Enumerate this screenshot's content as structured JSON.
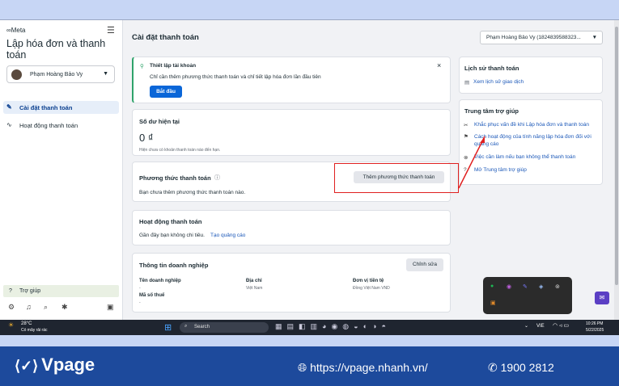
{
  "sidebar": {
    "brand": "∞Meta",
    "title": "Lập hóa đơn và thanh toán",
    "account_name": "Phạm Hoàng Bảo Vy",
    "nav": [
      {
        "label": "Cài đặt thanh toán"
      },
      {
        "label": "Hoạt động thanh toán"
      }
    ],
    "help_label": "Trợ giúp"
  },
  "header": {
    "title": "Cài đặt thanh toán",
    "account_selector": "Phạm Hoàng Bảo Vy (1824839588323..."
  },
  "setup": {
    "title": "Thiết lập tài khoản",
    "desc": "Chỉ cần thêm phương thức thanh toán và chỉ tiết lập hóa đơn lần đầu tiên",
    "button": "Bắt đầu",
    "close": "×"
  },
  "balance": {
    "title": "Số dư hiện tại",
    "value": "0 ₫",
    "note": "Hiện chưa có khoản thanh toán nào đến hạn."
  },
  "payment_method": {
    "title": "Phương thức thanh toán",
    "desc": "Bạn chưa thêm phương thức thanh toán nào.",
    "button": "Thêm phương thức thanh toán"
  },
  "activity": {
    "title": "Hoạt động thanh toán",
    "desc": "Gần đây bạn không chi tiêu.",
    "link": "Tạo quảng cáo"
  },
  "business": {
    "title": "Thông tin doanh nghiệp",
    "edit": "Chỉnh sửa",
    "fields": [
      {
        "label": "Tên doanh nghiệp",
        "value": "-"
      },
      {
        "label": "Địa chỉ",
        "value": "Việt Nam"
      },
      {
        "label": "Đơn vị tiền tệ",
        "value": "Đồng Việt Nam VND"
      },
      {
        "label": "Mã số thuế",
        "value": "-"
      }
    ]
  },
  "history": {
    "title": "Lịch sử thanh toán",
    "link": "Xem lịch sử giao dịch"
  },
  "help_center": {
    "title": "Trung tâm trợ giúp",
    "links": [
      "Khắc phục vấn đề khi Lập hóa đơn và thanh toán",
      "Cách hoạt động của tính năng lập hóa đơn đối với quảng cáo",
      "Việc cần làm nếu bạn không thể thanh toán",
      "Mở Trung tâm trợ giúp"
    ]
  },
  "taskbar": {
    "weather_temp": "28°C",
    "weather_desc": "Có mây rải rác",
    "search": "Search",
    "lang": "VIE",
    "time": "10:26 PM",
    "date": "5/22/2025"
  },
  "footer": {
    "brand": "Vpage",
    "url": "https://vpage.nhanh.vn/",
    "phone": "1900 2812"
  }
}
